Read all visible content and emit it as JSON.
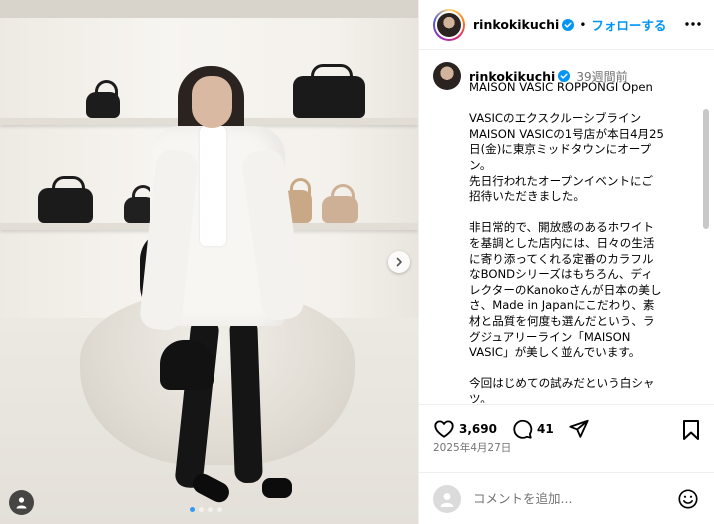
{
  "post": {
    "username": "rinkokikuchi",
    "follow_label": "フォローする",
    "separator": "•",
    "caption_time": "39週間前",
    "caption": "MAISON VASIC ROPPONGI Open\n\nVASICのエクスクルーシブライン\nMAISON VASICの1号店が本日4月25日(金)に東京ミッドタウンにオープン。\n先日行われたオープンイベントにご招待いただきました。\n\n非日常的で、開放感のあるホワイトを基調とした店内には、日々の生活に寄り添ってくれる定番のカラフルなBONDシリーズはもちろん、ディレクターのKanokoさんが日本の美しさ、Made in Japanにこだわり、素材と品質を何度も選んだという、ラグジュアリーライン「MAISON VASIC」が美しく並んでいます。\n\n今回はじめての試みだという白シャツ。\n普段の生活の中で、自分らしさに自信",
    "likes": "3,690",
    "comments": "41",
    "date": "2025年4月27日",
    "comment_placeholder": "コメントを追加...",
    "carousel": {
      "slides": 4,
      "active": 0
    }
  },
  "icons": {
    "verified": "verified-badge-icon",
    "more": "more-horizontal-icon",
    "like": "heart-icon",
    "comment": "comment-icon",
    "share": "share-icon",
    "save": "bookmark-icon",
    "emoji": "emoji-icon",
    "next": "chevron-right-icon",
    "user_tag": "user-tag-icon"
  },
  "colors": {
    "accent": "#0095f6",
    "verified": "#0095f6",
    "muted": "#737373",
    "border": "#efefef"
  }
}
